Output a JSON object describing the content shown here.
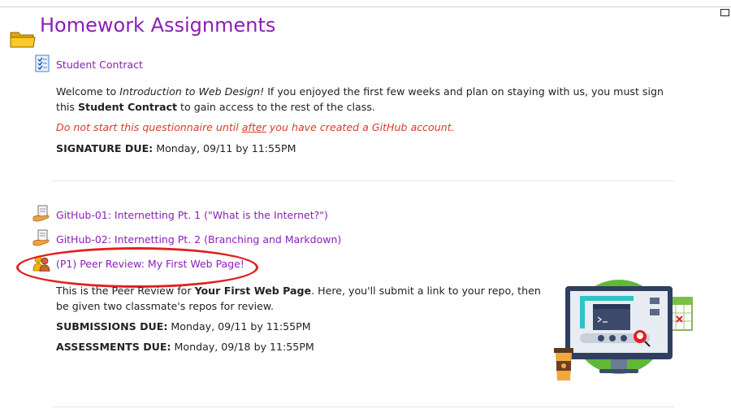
{
  "page": {
    "title": "Homework Assignments"
  },
  "student_contract": {
    "link": "Student Contract",
    "para1_a": "Welcome to ",
    "para1_course": "Introduction to Web Design!",
    "para1_b": " If you enjoyed the first few weeks and plan on staying with us, you must sign this ",
    "para1_strong": "Student Contract",
    "para1_c": " to gain access to the rest of the class.",
    "warning_a": "Do not start this questionnaire until ",
    "warning_u": "after",
    "warning_b": " you have created a GitHub account.",
    "due_label": "SIGNATURE DUE:",
    "due_value": " Monday, 09/11 by 11:55PM"
  },
  "activities": [
    {
      "label": "GitHub-01: Internetting Pt. 1 (\"What is the Internet?\")",
      "icon": "assignment-hand-icon"
    },
    {
      "label": "GitHub-02: Internetting Pt. 2 (Branching and Markdown)",
      "icon": "assignment-hand-icon"
    },
    {
      "label": "(P1) Peer Review: My First Web Page!",
      "icon": "workshop-people-icon"
    }
  ],
  "peer_review": {
    "para_a": "This is the Peer Review for ",
    "para_strong": "Your First Web Page",
    "para_b": ". Here, you'll submit a link to your repo, then be given two classmate's repos for review.",
    "submissions_label": "SUBMISSIONS DUE:",
    "submissions_value": " Monday, 09/11 by 11:55PM",
    "assessments_label": "ASSESSMENTS DUE:",
    "assessments_value": " Monday, 09/18 by 11:55PM"
  },
  "colors": {
    "link": "#8a1fb5",
    "warning": "#d63b2c",
    "highlight": "#e22020"
  }
}
